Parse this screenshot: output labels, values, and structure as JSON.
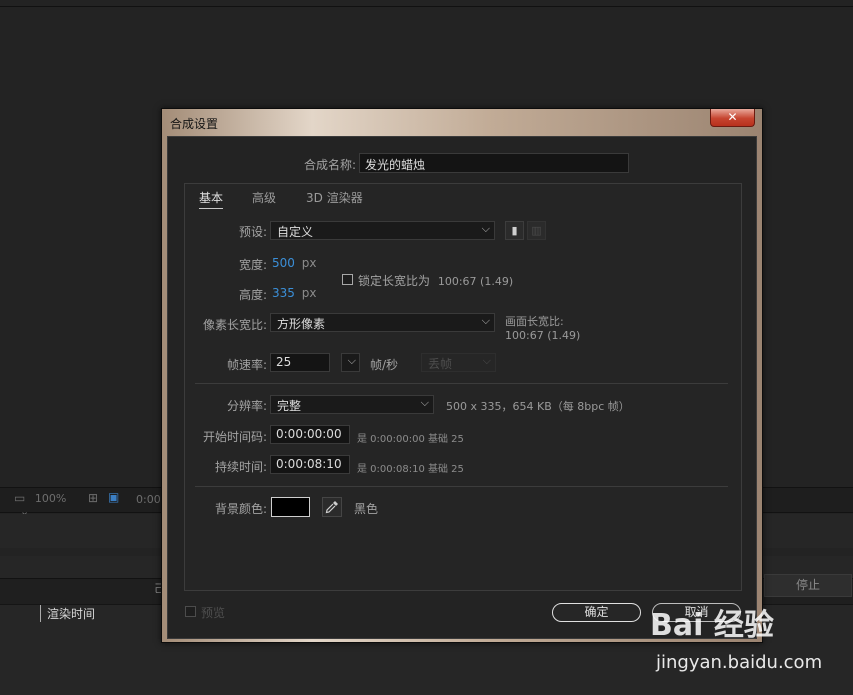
{
  "background": {
    "zoom": "100%",
    "timecode": "0:00",
    "render_time_label": "渲染时间",
    "stop_button": "停止",
    "partial_char": "己"
  },
  "dialog": {
    "title": "合成设置",
    "close_label": "✕",
    "comp_name_label": "合成名称:",
    "comp_name_value": "发光的蜡烛",
    "tabs": [
      {
        "label": "基本",
        "active": true
      },
      {
        "label": "高级",
        "active": false
      },
      {
        "label": "3D 渲染器",
        "active": false
      }
    ],
    "preset_label": "预设:",
    "preset_value": "自定义",
    "width_label": "宽度:",
    "width_value": "500",
    "height_label": "高度:",
    "height_value": "335",
    "unit_px": "px",
    "lock_aspect_label": "锁定长宽比为",
    "lock_aspect_value": "100:67 (1.49)",
    "lock_aspect_checked": false,
    "pixel_aspect_label": "像素长宽比:",
    "pixel_aspect_value": "方形像素",
    "frame_aspect_label": "画面长宽比:",
    "frame_aspect_value": "100:67 (1.49)",
    "frame_rate_label": "帧速率:",
    "frame_rate_value": "25",
    "frame_rate_unit": "帧/秒",
    "drop_frame_value": "丢帧",
    "resolution_label": "分辨率:",
    "resolution_value": "完整",
    "resolution_info": "500 x 335，654 KB（每 8bpc 帧）",
    "start_timecode_label": "开始时间码:",
    "start_timecode_value": "0:00:00:00",
    "start_timecode_note": "是 0:00:00:00  基础 25",
    "duration_label": "持续时间:",
    "duration_value": "0:00:08:10",
    "duration_note": "是 0:00:08:10  基础 25",
    "bg_color_label": "背景颜色:",
    "bg_color_name": "黑色",
    "bg_color_hex": "#000000",
    "preview_label": "预览",
    "ok_label": "确定",
    "cancel_label": "取消"
  },
  "watermark": {
    "logo": "Bai 经验",
    "url": "jingyan.baidu.com"
  }
}
